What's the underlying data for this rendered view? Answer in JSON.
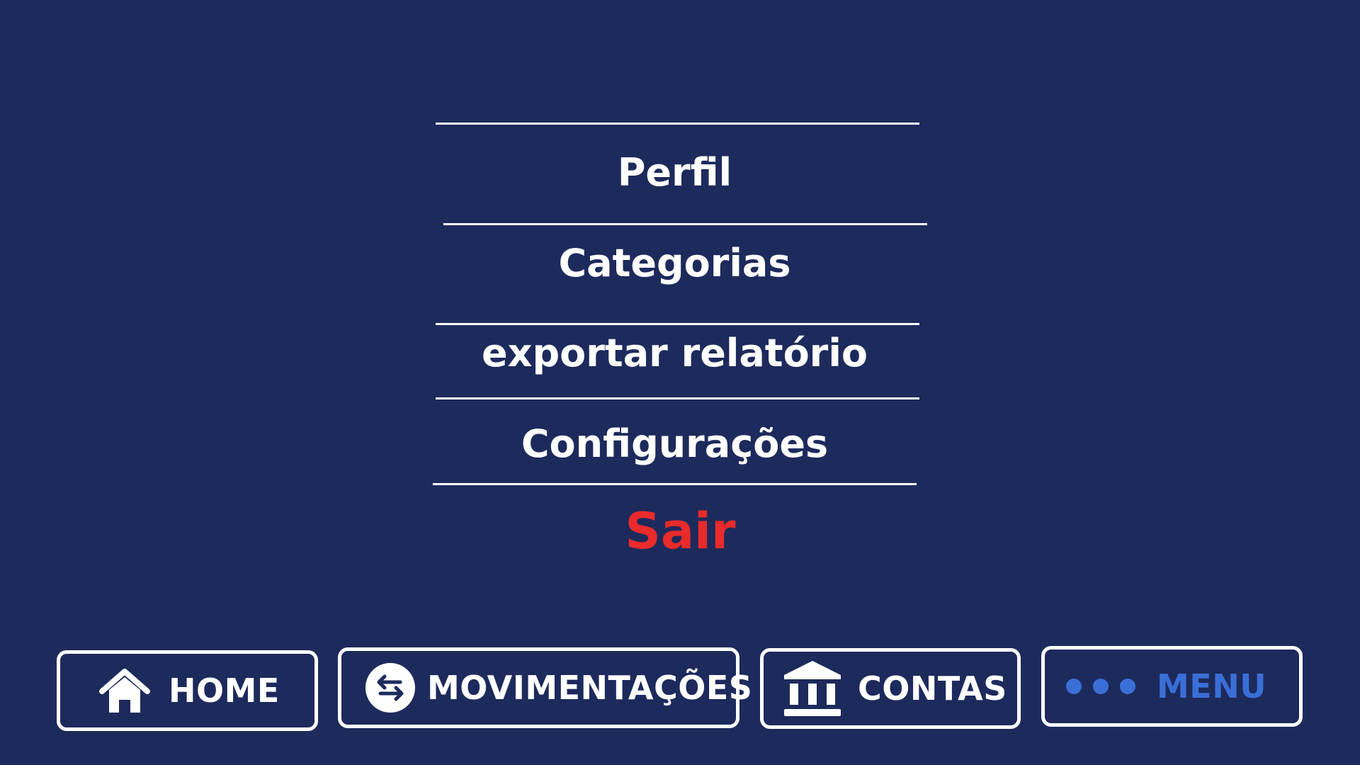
{
  "menu": {
    "items": [
      {
        "label": "Perfil"
      },
      {
        "label": "Categorias"
      },
      {
        "label": "exportar relatório"
      },
      {
        "label": "Configurações"
      }
    ],
    "exit_label": "Sair"
  },
  "bottom_nav": {
    "home_label": "HOME",
    "movements_label": "MOVIMENTAÇÕES",
    "accounts_label": "CONTAS",
    "menu_label": "MENU"
  },
  "colors": {
    "background": "#1d2a5c",
    "text": "#ffffff",
    "exit": "#e92b2b",
    "active_nav": "#3a6fd8"
  },
  "icons": {
    "home": "home-icon",
    "movements": "transfer-arrows-icon",
    "accounts": "bank-icon",
    "menu": "three-dots-icon"
  }
}
